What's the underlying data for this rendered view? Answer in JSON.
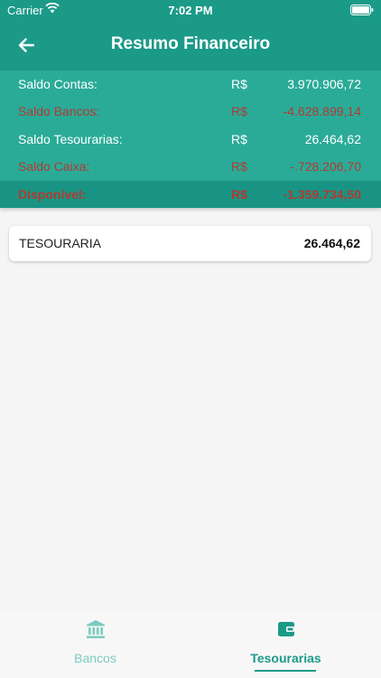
{
  "status_bar": {
    "carrier": "Carrier",
    "time": "7:02 PM"
  },
  "header": {
    "title": "Resumo Financeiro",
    "back_icon": "arrow-left-icon"
  },
  "summary": {
    "rows": [
      {
        "label": "Saldo Contas:",
        "currency": "R$",
        "value": "3.970.906,72"
      },
      {
        "label": "Saldo Bancos:",
        "currency": "R$",
        "value": "-4.628.899,14"
      },
      {
        "label": "Saldo Tesourarias:",
        "currency": "R$",
        "value": "26.464,62"
      },
      {
        "label": "Saldo Caixa:",
        "currency": "R$",
        "value": "-.728.206,70"
      },
      {
        "label": "Disponível:",
        "currency": "R$",
        "value": "-1.359.734,50"
      }
    ]
  },
  "list": {
    "items": [
      {
        "name": "TESOURARIA",
        "amount": "26.464,62"
      }
    ]
  },
  "tabbar": {
    "tabs": [
      {
        "label": "Bancos",
        "icon": "bank-icon",
        "active": false
      },
      {
        "label": "Tesourarias",
        "icon": "wallet-icon",
        "active": true
      }
    ]
  },
  "colors": {
    "primary": "#1b9a88",
    "summary_bg": "#2aab98",
    "negative": "#b23a32",
    "inactive_tab": "#7ccbbf"
  }
}
